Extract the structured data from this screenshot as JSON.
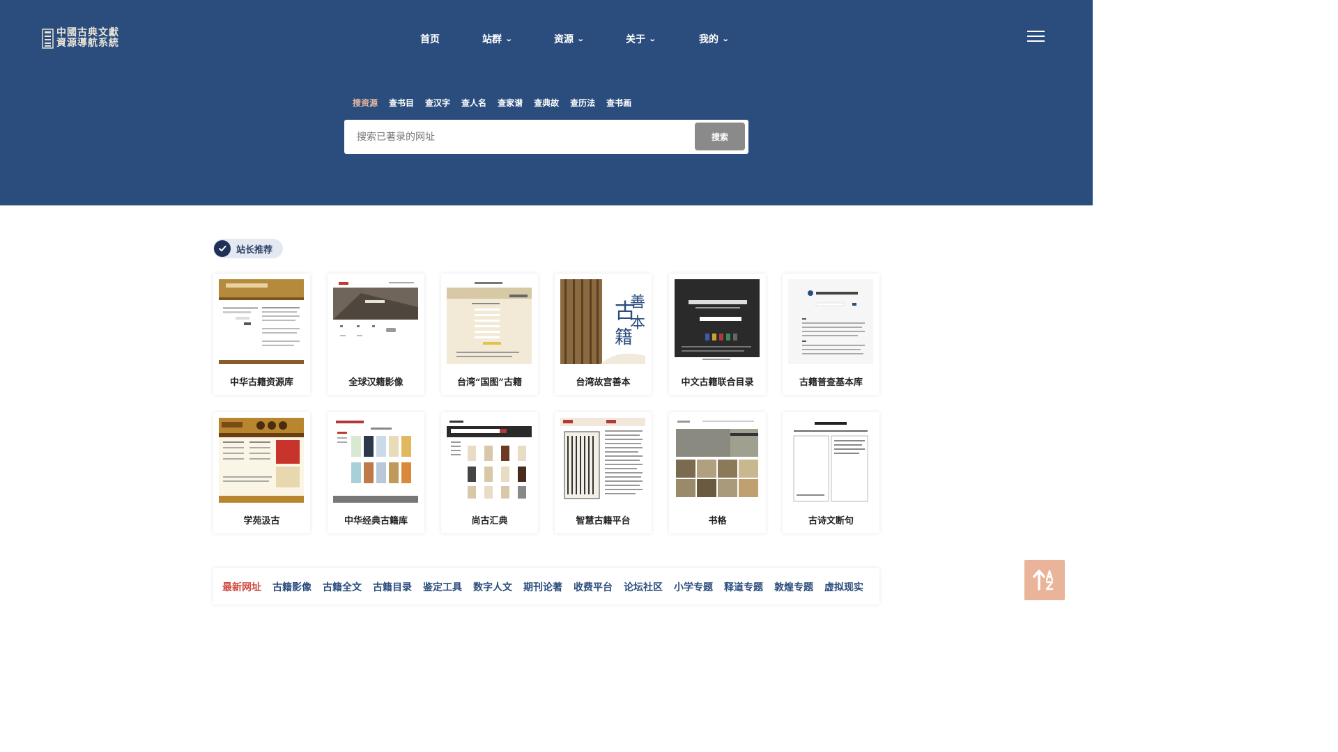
{
  "logo": {
    "line1": "中國古典文獻",
    "line2": "資源導航系統"
  },
  "nav": [
    {
      "label": "首页",
      "dropdown": false
    },
    {
      "label": "站群",
      "dropdown": true
    },
    {
      "label": "资源",
      "dropdown": true
    },
    {
      "label": "关于",
      "dropdown": true
    },
    {
      "label": "我的",
      "dropdown": true
    }
  ],
  "search": {
    "tabs": [
      "搜资源",
      "查书目",
      "查汉字",
      "查人名",
      "查家谱",
      "查典故",
      "查历法",
      "查书画"
    ],
    "active_tab": 0,
    "placeholder": "搜索已著录的网址",
    "button_label": "搜索"
  },
  "recommend": {
    "badge_label": "站长推荐",
    "items": [
      {
        "label": "中华古籍资源库"
      },
      {
        "label": "全球汉籍影像"
      },
      {
        "label": "台湾“国图”古籍"
      },
      {
        "label": "台湾故宫善本"
      },
      {
        "label": "中文古籍联合目录"
      },
      {
        "label": "古籍普查基本库"
      },
      {
        "label": "学苑汲古"
      },
      {
        "label": "中华经典古籍库"
      },
      {
        "label": "尚古汇典"
      },
      {
        "label": "智慧古籍平台"
      },
      {
        "label": "书格"
      },
      {
        "label": "古诗文断句"
      }
    ]
  },
  "categories": {
    "items": [
      "最新网址",
      "古籍影像",
      "古籍全文",
      "古籍目录",
      "鉴定工具",
      "数字人文",
      "期刊论著",
      "收费平台",
      "论坛社区",
      "小学专题",
      "释道专题",
      "敦煌专题",
      "虚拟现实"
    ],
    "active": 0
  },
  "icons": {
    "menu": "hamburger-menu-icon",
    "badge": "check-circle-icon",
    "sort": "sort-a-z-icon",
    "dropdown": "chevron-down-icon"
  },
  "colors": {
    "header_bg": "#2b4d7d",
    "active_tab": "#e8b79e",
    "active_category": "#d0473d",
    "category": "#2b4d7d",
    "search_button": "#8a8a8a",
    "sort_button": "#e9b49a"
  }
}
